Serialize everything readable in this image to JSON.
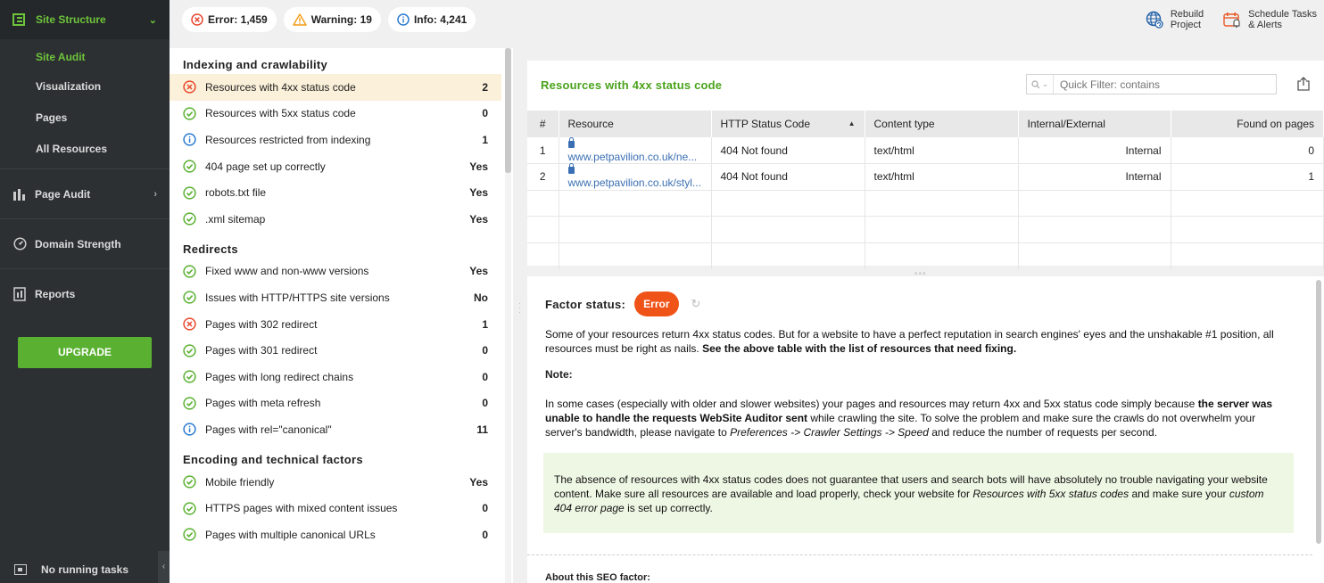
{
  "sidebar": {
    "header_label": "Site Structure",
    "sub_items": [
      "Site Audit",
      "Visualization",
      "Pages",
      "All Resources"
    ],
    "sections": [
      {
        "label": "Page Audit"
      },
      {
        "label": "Domain Strength"
      },
      {
        "label": "Reports"
      }
    ],
    "upgrade_label": "UPGRADE",
    "footer_label": "No running tasks"
  },
  "topbar": {
    "error_label": "Error: 1,459",
    "warning_label": "Warning: 19",
    "info_label": "Info: 4,241",
    "rebuild_line1": "Rebuild",
    "rebuild_line2": "Project",
    "schedule_line1": "Schedule Tasks",
    "schedule_line2": "& Alerts"
  },
  "factors": {
    "sections": [
      {
        "title": "Indexing and crawlability",
        "rows": [
          {
            "status": "error",
            "label": "Resources with 4xx status code",
            "value": "2"
          },
          {
            "status": "ok",
            "label": "Resources with 5xx status code",
            "value": "0"
          },
          {
            "status": "info",
            "label": "Resources restricted from indexing",
            "value": "1"
          },
          {
            "status": "ok",
            "label": "404 page set up correctly",
            "value": "Yes"
          },
          {
            "status": "ok",
            "label": "robots.txt file",
            "value": "Yes"
          },
          {
            "status": "ok",
            "label": ".xml sitemap",
            "value": "Yes"
          }
        ]
      },
      {
        "title": "Redirects",
        "rows": [
          {
            "status": "ok",
            "label": "Fixed www and non-www versions",
            "value": "Yes"
          },
          {
            "status": "ok",
            "label": "Issues with HTTP/HTTPS site versions",
            "value": "No"
          },
          {
            "status": "error",
            "label": "Pages with 302 redirect",
            "value": "1"
          },
          {
            "status": "ok",
            "label": "Pages with 301 redirect",
            "value": "0"
          },
          {
            "status": "ok",
            "label": "Pages with long redirect chains",
            "value": "0"
          },
          {
            "status": "ok",
            "label": "Pages with meta refresh",
            "value": "0"
          },
          {
            "status": "info",
            "label": "Pages with rel=\"canonical\"",
            "value": "11"
          }
        ]
      },
      {
        "title": "Encoding and technical factors",
        "rows": [
          {
            "status": "ok",
            "label": "Mobile friendly",
            "value": "Yes"
          },
          {
            "status": "ok",
            "label": "HTTPS pages with mixed content issues",
            "value": "0"
          },
          {
            "status": "ok",
            "label": "Pages with multiple canonical URLs",
            "value": "0"
          }
        ]
      }
    ]
  },
  "resources_panel": {
    "title": "Resources with 4xx status code",
    "filter_placeholder": "Quick Filter: contains",
    "columns": [
      "#",
      "Resource",
      "HTTP Status Code",
      "Content type",
      "Internal/External",
      "Found on pages"
    ],
    "rows": [
      {
        "num": "1",
        "resource": "www.petpavilion.co.uk/ne...",
        "status": "404 Not found",
        "type": "text/html",
        "internal": "Internal",
        "found": "0"
      },
      {
        "num": "2",
        "resource": "www.petpavilion.co.uk/styl...",
        "status": "404 Not found",
        "type": "text/html",
        "internal": "Internal",
        "found": "1"
      }
    ]
  },
  "details": {
    "factor_status_label": "Factor status:",
    "badge": "Error",
    "p1_text": "Some of your resources return 4xx status codes. But for a website to have a perfect reputation in search engines' eyes and the unshakable #1 position, all resources must be right as nails. ",
    "p1_bold": "See the above table with the list of resources that need fixing.",
    "note_label": "Note:",
    "p2_a": "In some cases (especially with older and slower websites) your pages and resources may return 4xx and 5xx status code simply because ",
    "p2_bold": "the server was unable to handle the requests WebSite Auditor sent",
    "p2_b": " while crawling the site. To solve the problem and make sure the crawls do not overwhelm your server's bandwidth, please navigate to ",
    "p2_italic": "Preferences -> Crawler Settings -> Speed",
    "p2_c": " and reduce the number of requests per second.",
    "box_a": "The absence of resources with 4xx status codes does not guarantee that users and search bots will have absolutely no trouble navigating your website content. Make sure all resources are available and load properly, check your website for ",
    "box_italic1": "Resources with 5xx status codes",
    "box_b": " and make sure your ",
    "box_italic2": "custom 404 error page",
    "box_c": " is set up correctly.",
    "about_label": "About this SEO factor:"
  },
  "colors": {
    "accent_green": "#6ec43b",
    "error": "#e8472f",
    "warning": "#f39c12",
    "info": "#2a7bd0",
    "ok": "#5ab131",
    "badge": "#f05318"
  }
}
